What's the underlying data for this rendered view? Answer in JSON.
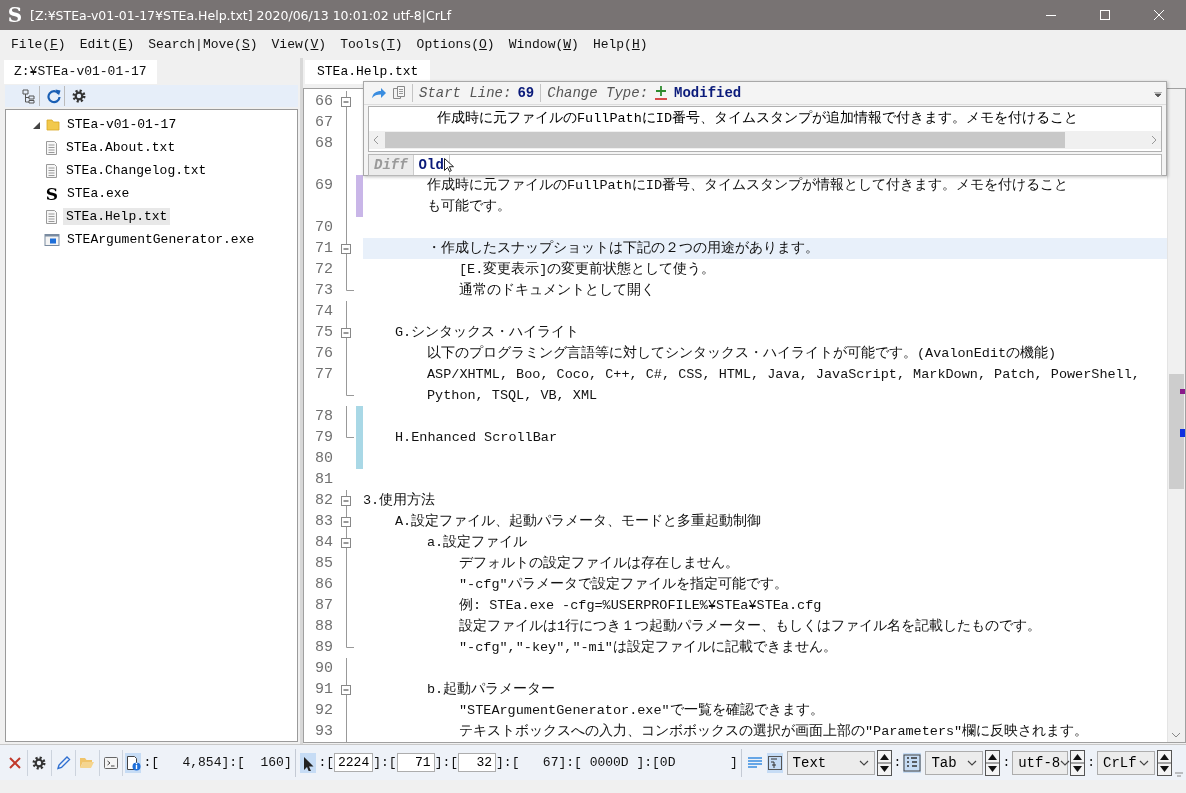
{
  "window": {
    "logo": "S",
    "title": "[Z:¥STEa-v01-01-17¥STEa.Help.txt] 2020/06/13 10:01:02 utf-8|CrLf"
  },
  "menu": [
    {
      "before": "File(",
      "key": "F",
      "after": ")"
    },
    {
      "before": "Edit(",
      "key": "E",
      "after": ")"
    },
    {
      "before": "Search|Move(",
      "key": "S",
      "after": ")"
    },
    {
      "before": "View(",
      "key": "V",
      "after": ")"
    },
    {
      "before": "Tools(",
      "key": "T",
      "after": ")"
    },
    {
      "before": "Options(",
      "key": "O",
      "after": ")"
    },
    {
      "before": "Window(",
      "key": "W",
      "after": ")"
    },
    {
      "before": "Help(",
      "key": "H",
      "after": ")"
    }
  ],
  "explorer": {
    "tab": {
      "label": "Z:¥STEa-v01-01-17",
      "selected": true
    },
    "tree": [
      {
        "label": "STEa-v01-01-17",
        "kind": "folder",
        "expanded": true,
        "selected": false,
        "children": [
          {
            "label": "STEa.About.txt",
            "kind": "text",
            "selected": false
          },
          {
            "label": "STEa.Changelog.txt",
            "kind": "text",
            "selected": false
          },
          {
            "label": "STEa.exe",
            "kind": "app",
            "glyph": "S",
            "selected": false
          },
          {
            "label": "STEa.Help.txt",
            "kind": "text",
            "selected": true
          },
          {
            "label": "STEArgumentGenerator.exe",
            "kind": "program",
            "selected": false
          }
        ]
      }
    ]
  },
  "editor": {
    "tab": {
      "label": "STEa.Help.txt",
      "selected": true
    },
    "lines": [
      {
        "number": "66",
        "kind": "fold-start",
        "wrapped": false,
        "highlighted": false
      },
      {
        "number": "67",
        "kind": "fold-line",
        "wrapped": false,
        "highlighted": false
      },
      {
        "number": "68",
        "kind": "fold-line",
        "wrapped": true,
        "highlighted": false
      },
      {
        "number": "69",
        "kind": "fold-line",
        "wrapped": true,
        "highlighted": false,
        "color": "#c9b6e8",
        "text": "\t\t作成時に元ファイルのFullPathにID番号、タイムスタンプが情報として付きます。メモを付けること",
        "continuation": "\t\tも可能です。"
      },
      {
        "number": "70",
        "kind": "fold-line",
        "wrapped": false,
        "highlighted": false
      },
      {
        "number": "71",
        "kind": "fold-start",
        "wrapped": false,
        "highlighted": true,
        "text": "\t\t・作成したスナップショットは下記の２つの用途があります。"
      },
      {
        "number": "72",
        "kind": "fold-line",
        "wrapped": false,
        "highlighted": false,
        "text": "\t\t\t[E.変更表示]の変更前状態として使う。"
      },
      {
        "number": "73",
        "kind": "fold-end",
        "wrapped": false,
        "highlighted": false,
        "text": "\t\t\t通常のドキュメントとして開く"
      },
      {
        "number": "74",
        "kind": "fold-line",
        "wrapped": false,
        "highlighted": false
      },
      {
        "number": "75",
        "kind": "fold-start",
        "wrapped": false,
        "highlighted": false,
        "text": "\tG.シンタックス・ハイライト"
      },
      {
        "number": "76",
        "kind": "fold-line",
        "wrapped": false,
        "highlighted": false,
        "text": "\t\t以下のプログラミング言語等に対してシンタックス・ハイライトが可能です。(AvalonEditの機能)"
      },
      {
        "number": "77",
        "kind": "fold-end",
        "wrapped": true,
        "highlighted": false,
        "text": "\t\tASP/XHTML, Boo, Coco, C++, C#, CSS, HTML, Java, JavaScript, MarkDown, Patch, PowerShell,",
        "continuation": "\t\tPython, TSQL, VB, XML"
      },
      {
        "number": "78",
        "kind": "fold-line",
        "wrapped": false,
        "highlighted": false,
        "color": "#a9d8e6"
      },
      {
        "number": "79",
        "kind": "fold-end",
        "wrapped": false,
        "highlighted": false,
        "color": "#a9d8e6",
        "text": "\tH.Enhanced ScrollBar"
      },
      {
        "number": "80",
        "kind": "plain",
        "wrapped": false,
        "highlighted": false,
        "color": "#a9d8e6"
      },
      {
        "number": "81",
        "kind": "plain",
        "wrapped": false,
        "highlighted": false
      },
      {
        "number": "82",
        "kind": "fold-start",
        "wrapped": false,
        "highlighted": false,
        "text": "3.使用方法"
      },
      {
        "number": "83",
        "kind": "fold-start",
        "wrapped": false,
        "highlighted": false,
        "text": "\tA.設定ファイル、起動パラメータ、モードと多重起動制御"
      },
      {
        "number": "84",
        "kind": "fold-start",
        "wrapped": false,
        "highlighted": false,
        "text": "\t\ta.設定ファイル"
      },
      {
        "number": "85",
        "kind": "fold-line",
        "wrapped": false,
        "highlighted": false,
        "text": "\t\t\tデフォルトの設定ファイルは存在しません。"
      },
      {
        "number": "86",
        "kind": "fold-line",
        "wrapped": false,
        "highlighted": false,
        "text": "\t\t\t\"-cfg\"パラメータで設定ファイルを指定可能です。"
      },
      {
        "number": "87",
        "kind": "fold-line",
        "wrapped": false,
        "highlighted": false,
        "text": "\t\t\t例: STEa.exe -cfg=%USERPROFILE%¥STEa¥STEa.cfg"
      },
      {
        "number": "88",
        "kind": "fold-line",
        "wrapped": false,
        "highlighted": false,
        "text": "\t\t\t設定ファイルは1行につき１つ起動パラメーター、もしくはファイル名を記載したものです。"
      },
      {
        "number": "89",
        "kind": "fold-end",
        "wrapped": false,
        "highlighted": false,
        "text": "\t\t\t\"-cfg\",\"-key\",\"-mi\"は設定ファイルに記載できません。"
      },
      {
        "number": "90",
        "kind": "fold-line",
        "wrapped": false,
        "highlighted": false
      },
      {
        "number": "91",
        "kind": "fold-start",
        "wrapped": false,
        "highlighted": false,
        "text": "\t\tb.起動パラメーター"
      },
      {
        "number": "92",
        "kind": "fold-line",
        "wrapped": false,
        "highlighted": false,
        "text": "\t\t\t\"STEArgumentGenerator.exe\"で一覧を確認できます。"
      },
      {
        "number": "93",
        "kind": "fold-line",
        "wrapped": false,
        "highlighted": false,
        "text": "\t\t\tテキストボックスへの入力、コンボボックスの選択が画面上部の\"Parameters\"欄に反映されます。"
      }
    ],
    "popup": {
      "start_label": "Start Line:",
      "start_value": "69",
      "type_label": "Change Type:",
      "type_value": "Modified",
      "text": "\t\t作成時に元ファイルのFullPathにID番号、タイムスタンプが追加情報で付きます。メモを付けること",
      "tabs": [
        {
          "label": "Diff",
          "selected": false
        },
        {
          "label": "Old",
          "selected": true
        }
      ]
    }
  },
  "status_bar": {
    "file_info": {
      "selected": true,
      "text": ":[   4,854]:[  160]"
    },
    "cursor": {
      "selected": true,
      "segments": [
        {
          "kind": "text",
          "text": ":["
        },
        {
          "kind": "field",
          "text": "2224"
        },
        {
          "kind": "text",
          "text": "]:["
        },
        {
          "kind": "field",
          "text": "71"
        },
        {
          "kind": "text",
          "text": "]:["
        },
        {
          "kind": "field",
          "text": "32"
        },
        {
          "kind": "text",
          "text": "]:[   67]:[ 0000D ]:[0D       ]"
        }
      ]
    },
    "controls": [
      {
        "kind": "wrap-toggle",
        "selected": false
      },
      {
        "kind": "syntax-toggle",
        "selected": true
      },
      {
        "kind": "combo",
        "value": "Text"
      },
      {
        "kind": "text",
        "text": ":"
      },
      {
        "kind": "indent-toggle",
        "selected": true
      },
      {
        "kind": "combo",
        "value": "Tab"
      },
      {
        "kind": "text",
        "text": ":"
      },
      {
        "kind": "combo",
        "value": "utf-8"
      },
      {
        "kind": "text",
        "text": ":"
      },
      {
        "kind": "combo",
        "value": "CrLf"
      }
    ]
  }
}
